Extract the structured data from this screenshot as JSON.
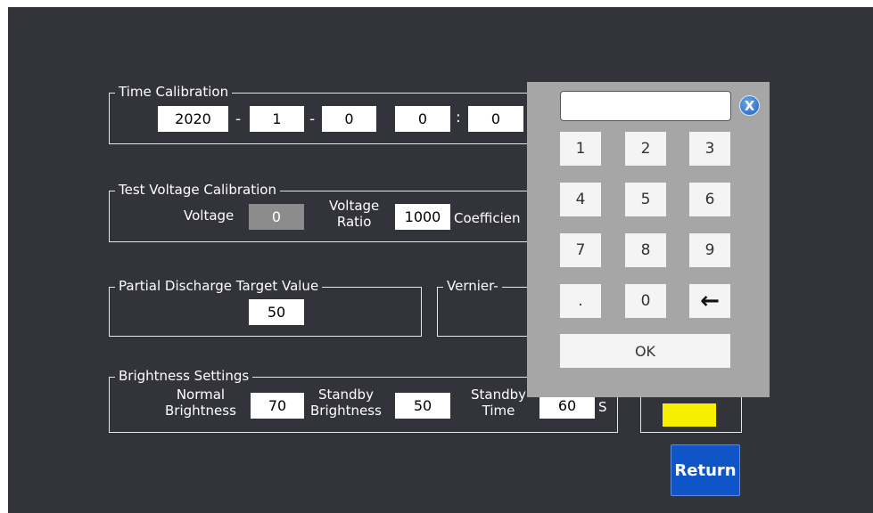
{
  "time_calibration": {
    "legend": "Time Calibration",
    "year": "2020",
    "month": "1",
    "day": "0",
    "hour": "0",
    "minute": "0",
    "sep_dash": "-",
    "sep_colon": ":"
  },
  "voltage_calibration": {
    "legend": "Test Voltage Calibration",
    "voltage_label": "Voltage",
    "voltage_value": "0",
    "ratio_label_line1": "Voltage",
    "ratio_label_line2": "Ratio",
    "ratio_value": "1000",
    "coefficient_label": "Coefficien"
  },
  "partial_discharge": {
    "legend": "Partial Discharge Target Value",
    "value": "50"
  },
  "vernier": {
    "legend": "Vernier-"
  },
  "brightness": {
    "legend": "Brightness Settings",
    "normal_line1": "Normal",
    "normal_line2": "Brightness",
    "normal_value": "70",
    "standby_line1": "Standby",
    "standby_line2": "Brightness",
    "standby_value": "50",
    "time_line1": "Standby",
    "time_line2": "Time",
    "time_value": "60",
    "time_unit": "S"
  },
  "keypad": {
    "display_value": "",
    "close_label": "X",
    "keys": [
      "1",
      "2",
      "3",
      "4",
      "5",
      "6",
      "7",
      "8",
      "9",
      ".",
      "0",
      "←"
    ],
    "ok_label": "OK"
  },
  "return_label": "Return",
  "colors": {
    "background": "#33333c",
    "keypad": "#a6a6a6",
    "indicator": "#f7ef00",
    "return_button": "#1055c8"
  }
}
